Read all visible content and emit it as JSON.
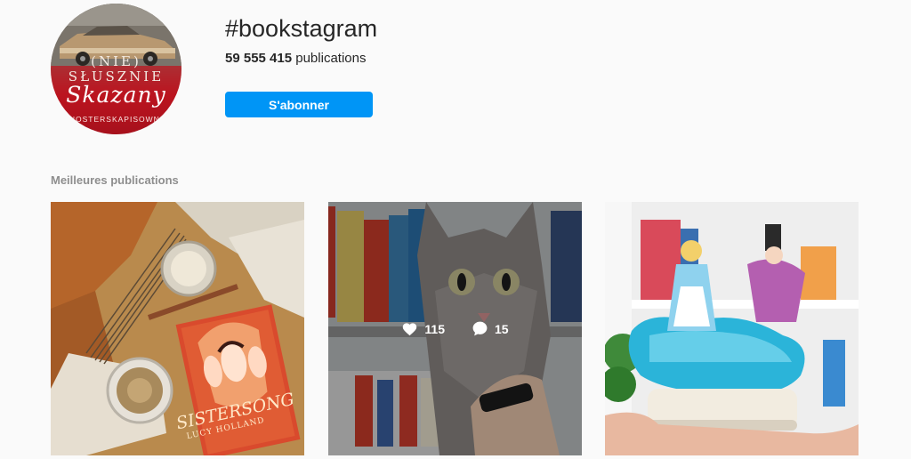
{
  "header": {
    "avatar": {
      "line1": "(NIE)",
      "line2": "SŁUSZNIE",
      "line3": "Skazany",
      "handle": "NOSTERSKAPISOWNI"
    },
    "hashtag": "#bookstagram",
    "post_count": "59 555 415",
    "post_count_label": "publications",
    "follow_label": "S'abonner"
  },
  "section": {
    "title": "Meilleures publications"
  },
  "posts": [
    {
      "name": "sistersong-book-flatlay",
      "book_title": "SISTERSONG",
      "book_author": "LUCY HOLLAND"
    },
    {
      "name": "cat-with-bookshelf",
      "likes": "115",
      "comments": "15"
    },
    {
      "name": "alice-in-wonderland-snowglobe"
    }
  ],
  "colors": {
    "accent": "#0095f6",
    "background": "#fafafa",
    "muted_text": "#8e8e8e"
  }
}
